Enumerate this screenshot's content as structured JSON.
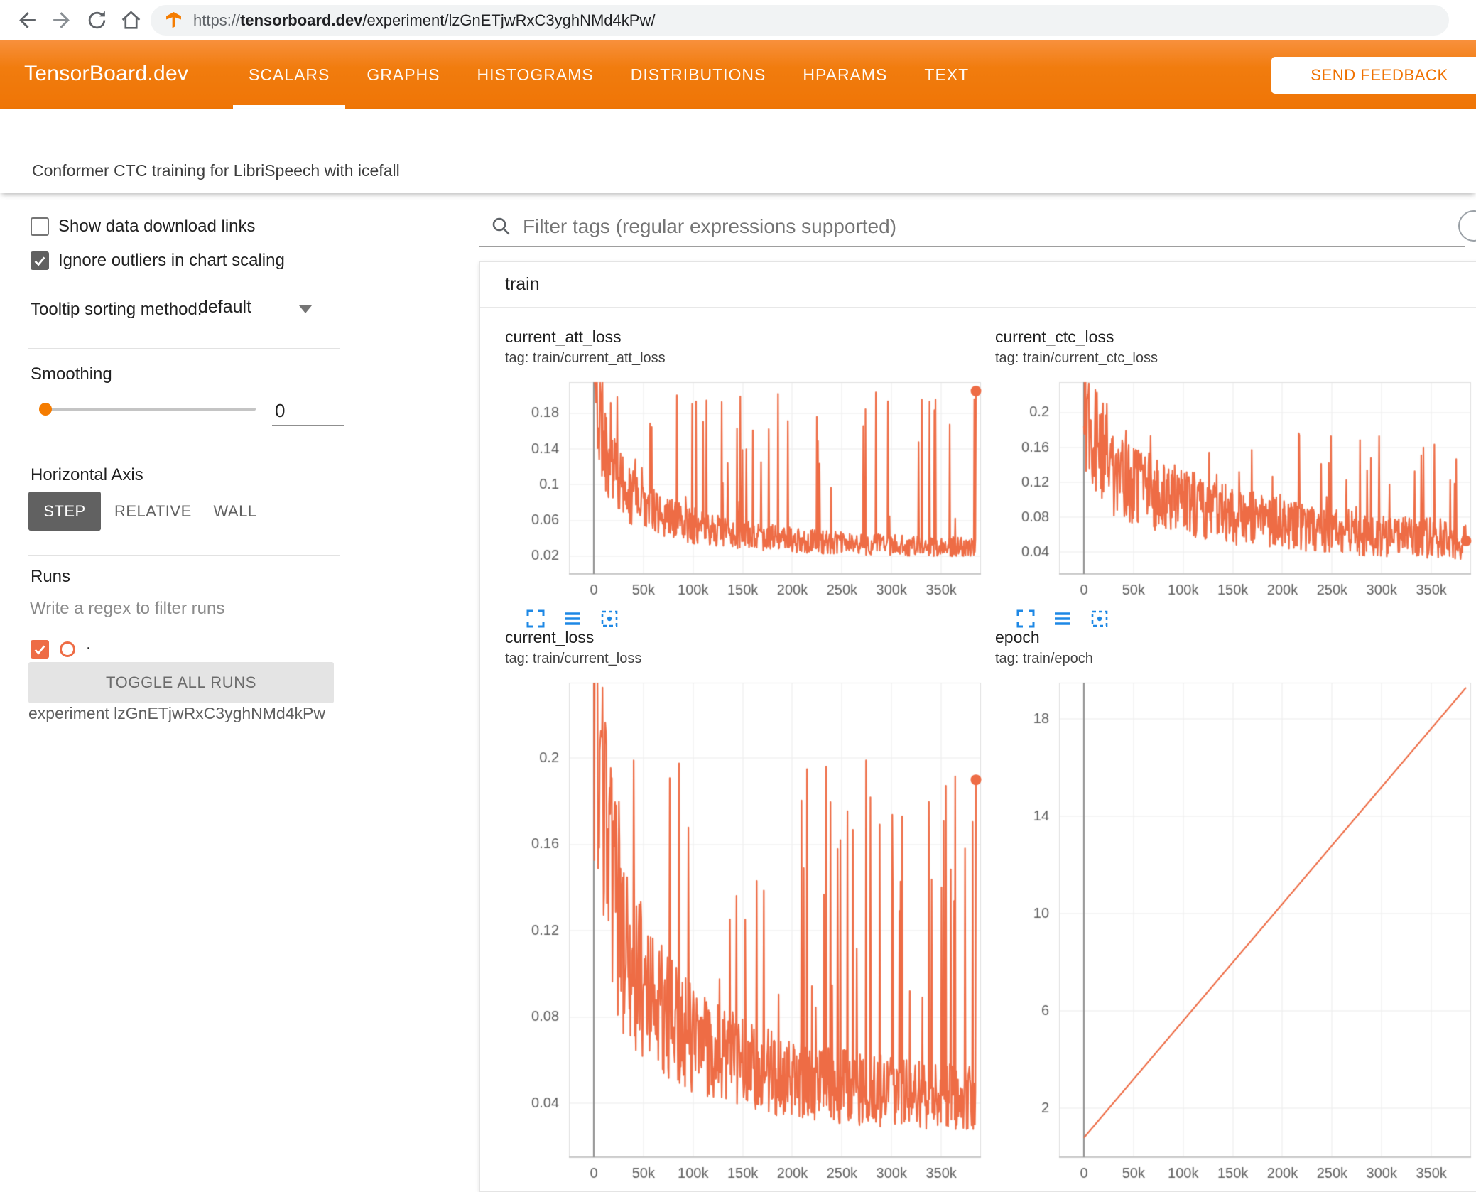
{
  "browser": {
    "url_scheme": "https://",
    "url_domain": "tensorboard.dev",
    "url_path": "/experiment/lzGnETjwRxC3yghNMd4kPw/"
  },
  "header": {
    "brand": "TensorBoard.dev",
    "tabs": [
      {
        "label": "SCALARS",
        "active": true
      },
      {
        "label": "GRAPHS",
        "active": false
      },
      {
        "label": "HISTOGRAMS",
        "active": false
      },
      {
        "label": "DISTRIBUTIONS",
        "active": false
      },
      {
        "label": "HPARAMS",
        "active": false
      },
      {
        "label": "TEXT",
        "active": false
      }
    ],
    "feedback_label": "SEND FEEDBACK"
  },
  "subtitle": "Conformer CTC training for LibriSpeech with icefall",
  "sidebar": {
    "show_download_label": "Show data download links",
    "ignore_outliers_label": "Ignore outliers in chart scaling",
    "tooltip_sorting_label": "Tooltip sorting method:",
    "tooltip_sorting_value": "default",
    "smoothing_label": "Smoothing",
    "smoothing_value": "0",
    "horizontal_axis_label": "Horizontal Axis",
    "axis_buttons": [
      {
        "label": "STEP",
        "active": true
      },
      {
        "label": "RELATIVE",
        "active": false
      },
      {
        "label": "WALL",
        "active": false
      }
    ],
    "runs_label": "Runs",
    "runs_filter_placeholder": "Write a regex to filter runs",
    "run_item_label": ".",
    "toggle_all_label": "TOGGLE ALL RUNS",
    "experiment_label": "experiment lzGnETjwRxC3yghNMd4kPw"
  },
  "main": {
    "filter_placeholder": "Filter tags (regular expressions supported)",
    "card_title": "train"
  },
  "colors": {
    "accent_orange": "#f17c0e",
    "run_color": "#ee6c45",
    "icon_blue": "#1e88e5"
  },
  "chart_data": [
    {
      "type": "line",
      "title": "current_att_loss",
      "tag": "tag: train/current_att_loss",
      "x_domain": [
        -25000,
        390000
      ],
      "x_ticks": [
        0,
        50000,
        100000,
        150000,
        200000,
        250000,
        300000,
        350000
      ],
      "x_tick_labels": [
        "0",
        "50k",
        "100k",
        "150k",
        "200k",
        "250k",
        "300k",
        "350k"
      ],
      "y_domain": [
        0,
        0.215
      ],
      "y_ticks": [
        0.02,
        0.06,
        0.1,
        0.14,
        0.18
      ],
      "y_tick_labels": [
        "0.02",
        "0.06",
        "0.1",
        "0.14",
        "0.18"
      ],
      "grid": true,
      "end_dot": true,
      "series": {
        "name": ".",
        "color": "#ee6c45",
        "seed": 11,
        "envelope": [
          [
            0,
            0.21
          ],
          [
            5000,
            0.175
          ],
          [
            15000,
            0.125
          ],
          [
            30000,
            0.092
          ],
          [
            60000,
            0.068
          ],
          [
            100000,
            0.052
          ],
          [
            150000,
            0.043
          ],
          [
            200000,
            0.037
          ],
          [
            260000,
            0.033
          ],
          [
            320000,
            0.031
          ],
          [
            385000,
            0.029
          ]
        ],
        "noise_lo": 0.65,
        "noise_hi": 1.4,
        "spike_prob": 0.07,
        "spike_max": 0.205,
        "floor": 0.014,
        "end_step": 385000,
        "end_value": 0.205
      }
    },
    {
      "type": "line",
      "title": "current_ctc_loss",
      "tag": "tag: train/current_ctc_loss",
      "x_domain": [
        -25000,
        390000
      ],
      "x_ticks": [
        0,
        50000,
        100000,
        150000,
        200000,
        250000,
        300000,
        350000
      ],
      "x_tick_labels": [
        "0",
        "50k",
        "100k",
        "150k",
        "200k",
        "250k",
        "300k",
        "350k"
      ],
      "y_domain": [
        0.015,
        0.235
      ],
      "y_ticks": [
        0.04,
        0.08,
        0.12,
        0.16,
        0.2
      ],
      "y_tick_labels": [
        "0.04",
        "0.08",
        "0.12",
        "0.16",
        "0.2"
      ],
      "grid": true,
      "end_dot": true,
      "series": {
        "name": ".",
        "color": "#ee6c45",
        "seed": 22,
        "envelope": [
          [
            0,
            0.23
          ],
          [
            5000,
            0.2
          ],
          [
            15000,
            0.165
          ],
          [
            30000,
            0.135
          ],
          [
            60000,
            0.11
          ],
          [
            100000,
            0.092
          ],
          [
            150000,
            0.08
          ],
          [
            200000,
            0.07
          ],
          [
            260000,
            0.062
          ],
          [
            320000,
            0.056
          ],
          [
            385000,
            0.053
          ]
        ],
        "noise_lo": 0.6,
        "noise_hi": 1.45,
        "spike_prob": 0.05,
        "spike_max": 0.18,
        "floor": 0.022,
        "end_step": 385000,
        "end_value": 0.053
      }
    },
    {
      "type": "line",
      "title": "current_loss",
      "tag": "tag: train/current_loss",
      "x_domain": [
        -25000,
        390000
      ],
      "x_ticks": [
        0,
        50000,
        100000,
        150000,
        200000,
        250000,
        300000,
        350000
      ],
      "x_tick_labels": [
        "0",
        "50k",
        "100k",
        "150k",
        "200k",
        "250k",
        "300k",
        "350k"
      ],
      "y_domain": [
        0.015,
        0.235
      ],
      "y_ticks": [
        0.04,
        0.08,
        0.12,
        0.16,
        0.2
      ],
      "y_tick_labels": [
        "0.04",
        "0.08",
        "0.12",
        "0.16",
        "0.2"
      ],
      "grid": true,
      "end_dot": true,
      "series": {
        "name": ".",
        "color": "#ee6c45",
        "seed": 33,
        "envelope": [
          [
            0,
            0.235
          ],
          [
            5000,
            0.195
          ],
          [
            15000,
            0.145
          ],
          [
            30000,
            0.108
          ],
          [
            60000,
            0.086
          ],
          [
            100000,
            0.068
          ],
          [
            150000,
            0.057
          ],
          [
            200000,
            0.05
          ],
          [
            260000,
            0.046
          ],
          [
            320000,
            0.043
          ],
          [
            385000,
            0.041
          ]
        ],
        "noise_lo": 0.65,
        "noise_hi": 1.4,
        "spike_prob": 0.07,
        "spike_max": 0.2,
        "floor": 0.028,
        "end_step": 385000,
        "end_value": 0.19
      }
    },
    {
      "type": "line",
      "title": "epoch",
      "tag": "tag: train/epoch",
      "x_domain": [
        -25000,
        390000
      ],
      "x_ticks": [
        0,
        50000,
        100000,
        150000,
        200000,
        250000,
        300000,
        350000
      ],
      "x_tick_labels": [
        "0",
        "50k",
        "100k",
        "150k",
        "200k",
        "250k",
        "300k",
        "350k"
      ],
      "y_domain": [
        0,
        19.5
      ],
      "y_ticks": [
        2,
        6,
        10,
        14,
        18
      ],
      "y_tick_labels": [
        "2",
        "6",
        "10",
        "14",
        "18"
      ],
      "grid": true,
      "end_dot": false,
      "series": {
        "name": ".",
        "color": "#ee6c45",
        "points": [
          [
            0,
            0.8
          ],
          [
            385000,
            19.3
          ]
        ]
      }
    }
  ]
}
